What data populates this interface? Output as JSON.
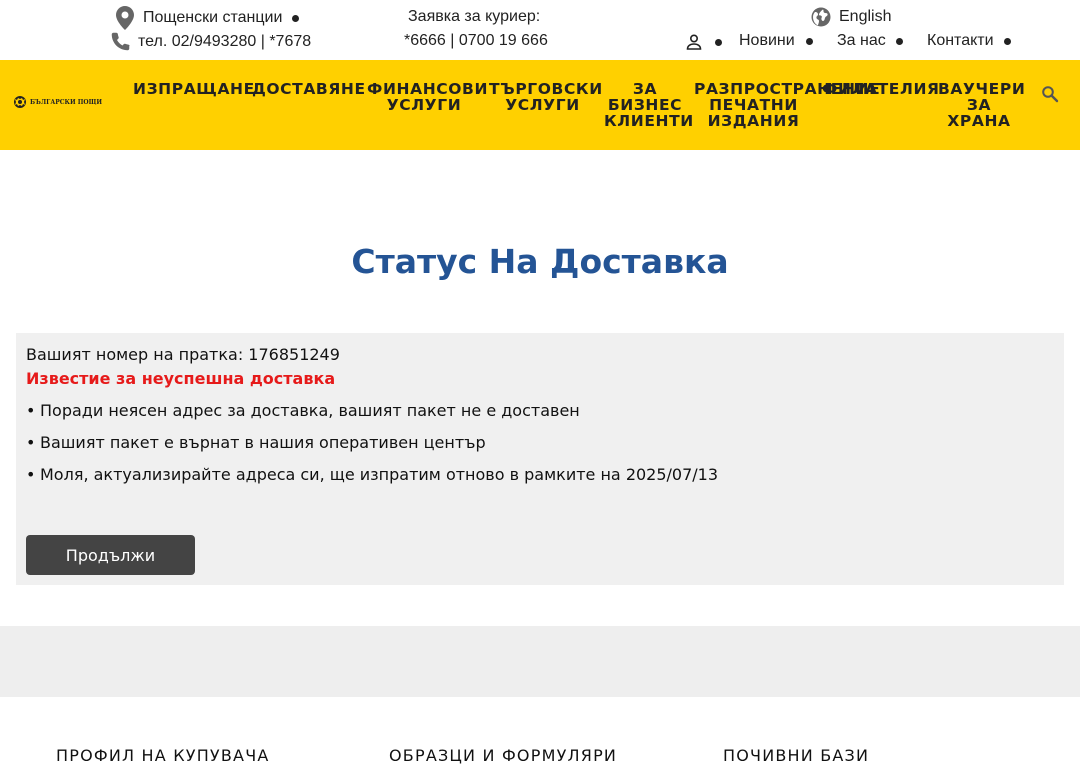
{
  "topbar": {
    "post_offices": "Пощенски станции",
    "phone": "тел. 02/9493280 |  *7678",
    "courier_label": "Заявка за куриер:",
    "courier_numbers": "*6666 | 0700 19 666",
    "language": "English",
    "links": [
      "Новини",
      "За нас",
      "Контакти"
    ]
  },
  "logo": {
    "name": "БЪЛГАРСКИ ПОЩИ"
  },
  "nav": {
    "items": [
      "ИЗПРАЩАНЕ",
      "ДОСТАВЯНЕ",
      "ФИНАНСОВИ\nУСЛУГИ",
      "ТЪРГОВСКИ\nУСЛУГИ",
      "ЗА\nБИЗНЕС\nКЛИЕНТИ",
      "РАЗПРОСТРАНЕНИЕ\nПЕЧАТНИ\nИЗДАНИЯ",
      "ФИЛАТЕЛИЯ",
      "ВАУЧЕРИ\nЗА\nХРАНА"
    ]
  },
  "main": {
    "title": "Статус На Доставка",
    "tracking": "Вашият номер на пратка: 176851249",
    "alert": "Известие за неуспешна доставка",
    "bullets": [
      "Поради неясен адрес за доставка, вашият пакет не е доставен",
      "Вашият пакет е върнат в нашия оперативен център",
      "Моля, актуализирайте адреса си, ще изпратим отново в рамките на 2025/07/13"
    ],
    "continue_label": "Продължи"
  },
  "footer": {
    "columns": [
      "ПРОФИЛ НА КУПУВАЧА",
      "ОБРАЗЦИ И ФОРМУЛЯРИ",
      "ПОЧИВНИ БАЗИ"
    ]
  },
  "colors": {
    "nav_bg": "#ffd000",
    "title": "#245495",
    "alert": "#e61a1a",
    "button": "#444444"
  }
}
